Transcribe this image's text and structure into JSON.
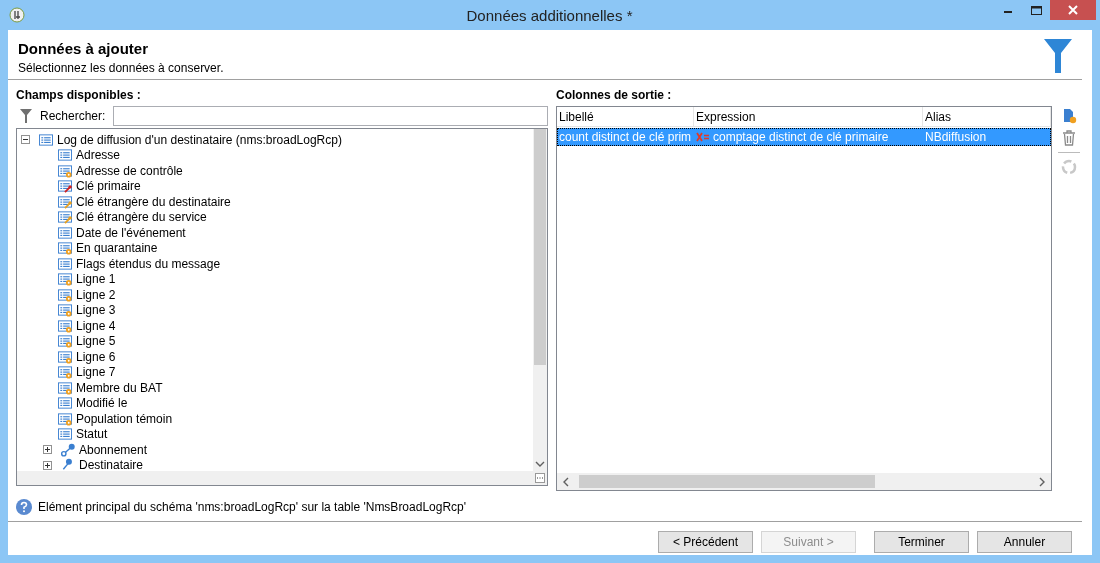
{
  "window": {
    "title": "Données additionnelles *"
  },
  "header": {
    "title": "Données à ajouter",
    "subtitle": "Sélectionnez les données à conserver."
  },
  "available": {
    "label": "Champs disponibles :",
    "search_label": "Rechercher:",
    "tree": {
      "label": "Log de diffusion d'un destinataire (nms:broadLogRcp)",
      "kind": "list",
      "expanded": true,
      "children": [
        {
          "label": "Adresse",
          "kind": "list"
        },
        {
          "label": "Adresse de contrôle",
          "kind": "gear"
        },
        {
          "label": "Clé primaire",
          "kind": "primary-key"
        },
        {
          "label": "Clé étrangère du destinataire",
          "kind": "foreign-key"
        },
        {
          "label": "Clé étrangère du service",
          "kind": "foreign-key"
        },
        {
          "label": "Date de l'événement",
          "kind": "list"
        },
        {
          "label": "En quarantaine",
          "kind": "gear"
        },
        {
          "label": "Flags étendus du message",
          "kind": "list"
        },
        {
          "label": "Ligne 1",
          "kind": "gear"
        },
        {
          "label": "Ligne 2",
          "kind": "gear"
        },
        {
          "label": "Ligne 3",
          "kind": "gear"
        },
        {
          "label": "Ligne 4",
          "kind": "gear"
        },
        {
          "label": "Ligne 5",
          "kind": "gear"
        },
        {
          "label": "Ligne 6",
          "kind": "gear"
        },
        {
          "label": "Ligne 7",
          "kind": "gear"
        },
        {
          "label": "Membre du BAT",
          "kind": "gear"
        },
        {
          "label": "Modifié le",
          "kind": "list"
        },
        {
          "label": "Population témoin",
          "kind": "gear"
        },
        {
          "label": "Statut",
          "kind": "list"
        },
        {
          "label": "Abonnement",
          "kind": "link",
          "expanded": false
        },
        {
          "label": "Destinataire",
          "kind": "node",
          "expanded": false
        }
      ]
    }
  },
  "output": {
    "label": "Colonnes de sortie :",
    "columns": [
      "Libellé",
      "Expression",
      "Alias"
    ],
    "rows": [
      {
        "label": "count distinct de clé prim",
        "expression": "comptage distinct de clé primaire",
        "alias": "NBdiffusion",
        "selected": true
      }
    ]
  },
  "info": "Elément principal du schéma 'nms:broadLogRcp' sur la table 'NmsBroadLogRcp'",
  "buttons": [
    {
      "label": "< Précédent",
      "disabled": false
    },
    {
      "label": "Suivant >",
      "disabled": true
    },
    {
      "label": "Terminer",
      "disabled": false
    },
    {
      "label": "Annuler",
      "disabled": false
    }
  ]
}
